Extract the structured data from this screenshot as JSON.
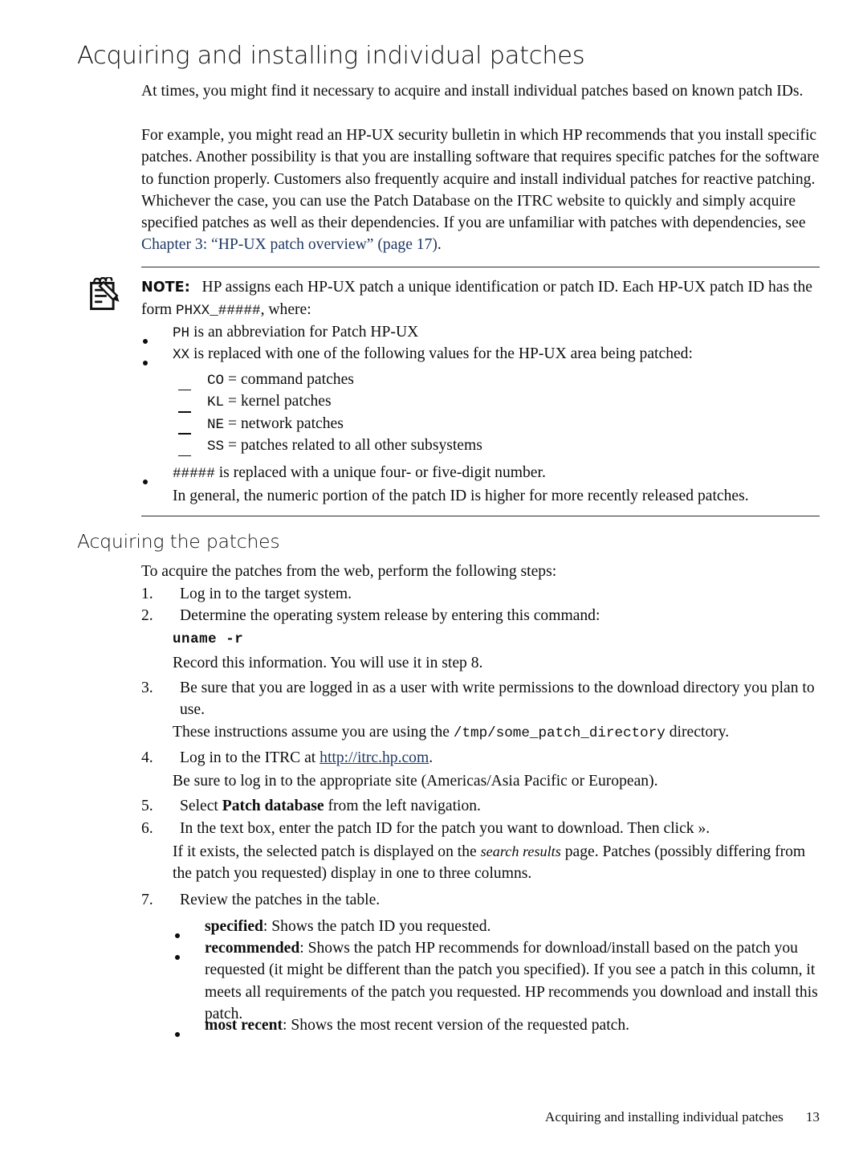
{
  "document": {
    "heading": "Acquiring and installing individual patches",
    "subheading": "Acquiring the patches"
  },
  "intro": {
    "para1": "At times, you might find it necessary to acquire and install individual patches based on known patch IDs.",
    "para2_a": "For example, you might read an HP-UX security bulletin in which HP recommends that you install specific patches. Another possibility is that you are installing software that requires specific patches for the software to function properly. Customers also frequently acquire and install individual patches for reactive patching. Whichever the case, you can use the Patch Database on the ITRC website to quickly and simply acquire specified patches as well as their dependencies. If you are unfamiliar with patches with dependencies, see ",
    "para2_link": "Chapter 3: “HP-UX patch overview”",
    "para2_pagelink": "(page 17)",
    "para2_end": "."
  },
  "note": {
    "icon": "note-pad-pencil-icon",
    "label": "NOTE:",
    "text_a": "HP assigns each HP-UX patch a unique identification or patch ID. Each HP-UX patch ID has the form ",
    "text_code": "PHXX_#####",
    "text_b": ", where:",
    "bullets": [
      {
        "code": "PH",
        "text": " is an abbreviation for Patch HP-UX"
      },
      {
        "code": "XX",
        "text": " is replaced with one of the following values for the HP-UX area being patched:"
      }
    ],
    "dashes": [
      {
        "code": "CO",
        "text": " = command patches"
      },
      {
        "code": "KL",
        "text": " = kernel patches"
      },
      {
        "code": "NE",
        "text": " = network patches"
      },
      {
        "code": "SS",
        "text": " = patches related to all other subsystems"
      }
    ],
    "bullet_last": {
      "code": "#####",
      "text": " is replaced with a unique four- or five-digit number."
    },
    "closing": "In general, the numeric portion of the patch ID is higher for more recently released patches."
  },
  "acquiring": {
    "lead": "To acquire the patches from the web, perform the following steps:",
    "steps": [
      {
        "num": "1.",
        "text": "Log in to the target system."
      },
      {
        "num": "2.",
        "text": "Determine the operating system release by entering this command:",
        "command": "uname -r",
        "after": "Record this information. You will use it in step 8."
      },
      {
        "num": "3.",
        "text": "Be sure that you are logged in as a user with write permissions to the download directory you plan to use.",
        "after_a": "These instructions assume you are using the ",
        "after_code": "/tmp/some_patch_directory",
        "after_b": " directory."
      },
      {
        "num": "4.",
        "text_a": "Log in to the ITRC at ",
        "link": "http://itrc.hp.com",
        "text_b": ".",
        "after": "Be sure to log in to the appropriate site (Americas/Asia Pacific or European)."
      },
      {
        "num": "5.",
        "text_a": "Select ",
        "bold": "Patch database",
        "text_b": " from the left navigation."
      },
      {
        "num": "6.",
        "text": "In the text box, enter the patch ID for the patch you want to download. Then click ».",
        "after_a": "If it exists, the selected patch is displayed on the ",
        "after_ital": "search results",
        "after_b": " page. Patches (possibly differing from the patch you requested) display in one to three columns."
      },
      {
        "num": "7.",
        "text": "Review the patches in the table."
      }
    ],
    "column_bullets": [
      {
        "bold": "specified",
        "text": ": Shows the patch ID you requested."
      },
      {
        "bold": "recommended",
        "text": ": Shows the patch HP recommends for download/install based on the patch you requested (it might be different than the patch you specified). If you see a patch in this column, it meets all requirements of the patch you requested. HP recommends you download and install this patch."
      },
      {
        "bold": "most recent",
        "text": ": Shows the most recent version of the requested patch."
      }
    ]
  },
  "footer": {
    "title": "Acquiring and installing individual patches",
    "page": "13"
  },
  "colors": {
    "link": "#1f3864",
    "text": "#0d0d0d",
    "rule": "#2a2a2a"
  }
}
